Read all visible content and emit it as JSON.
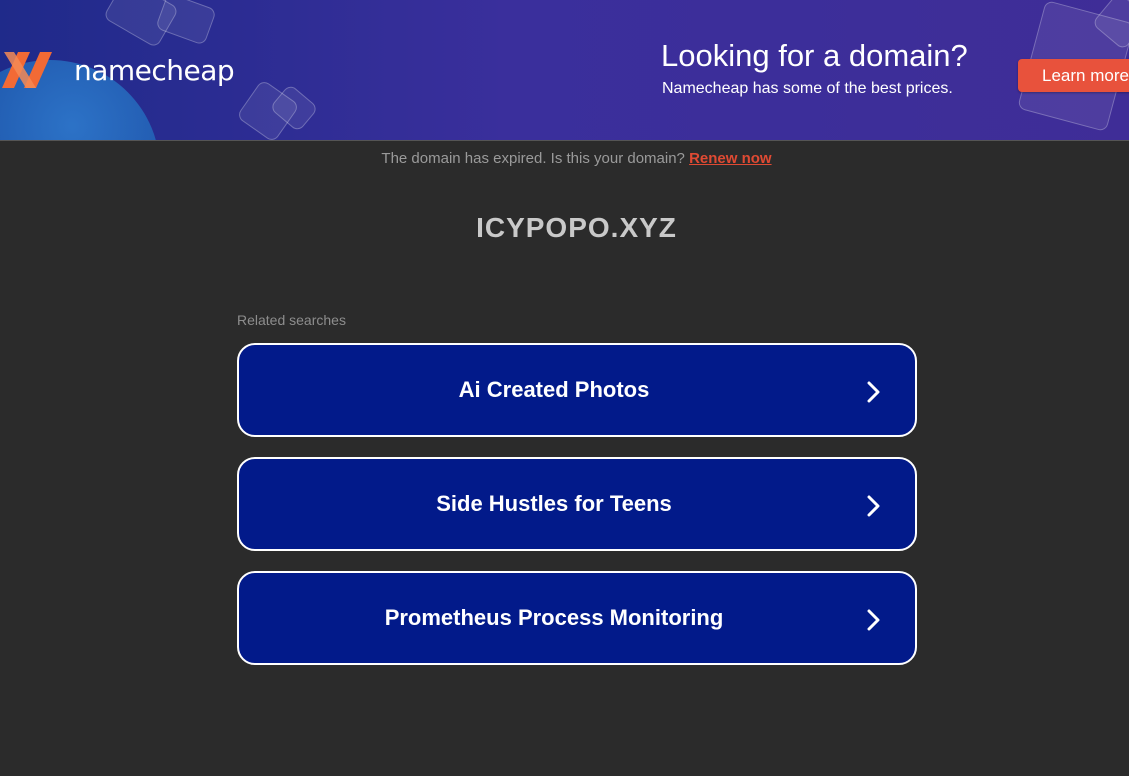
{
  "banner": {
    "brand": "namecheap",
    "headline": "Looking for a domain?",
    "subheadline": "Namecheap has some of the best prices.",
    "cta_label": "Learn more",
    "colors": {
      "cta": "#e8523c",
      "logo_orange": "#f26a35"
    }
  },
  "notice": {
    "text": "The domain has expired. Is this your domain? ",
    "link_label": "Renew now"
  },
  "domain_name": "ICYPOPO.XYZ",
  "related": {
    "heading": "Related searches",
    "items": [
      {
        "label": "Ai Created Photos",
        "icon": "chevron-right-icon"
      },
      {
        "label": "Side Hustles for Teens",
        "icon": "chevron-right-icon"
      },
      {
        "label": "Prometheus Process Monitoring",
        "icon": "chevron-right-icon"
      }
    ]
  }
}
